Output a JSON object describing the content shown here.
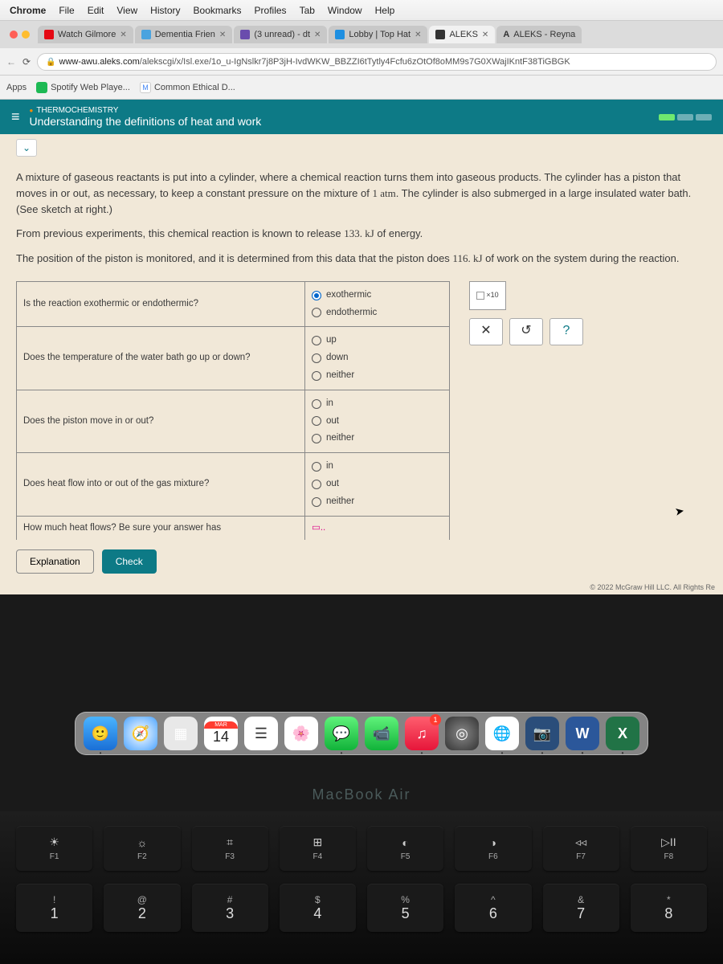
{
  "macMenu": {
    "app": "Chrome",
    "items": [
      "File",
      "Edit",
      "View",
      "History",
      "Bookmarks",
      "Profiles",
      "Tab",
      "Window",
      "Help"
    ]
  },
  "tabs": [
    {
      "label": "Watch Gilmore",
      "favi": "#e50914"
    },
    {
      "label": "Dementia Frien",
      "favi": "#4aa3df"
    },
    {
      "label": "(3 unread) - dt",
      "favi": "#6a4cad"
    },
    {
      "label": "Lobby | Top Hat",
      "favi": "#1e8fe1"
    },
    {
      "label": "ALEKS",
      "favi": "#333",
      "active": true
    },
    {
      "label": "ALEKS - Reyna",
      "favi": "#333"
    }
  ],
  "url": {
    "host": "www-awu.aleks.com",
    "path": "/alekscgi/x/Isl.exe/1o_u-IgNslkr7j8P3jH-IvdWKW_BBZZI6tTytly4Fcfu6zOtOf8oMM9s7G0XWajIKntF38TiGBGK"
  },
  "apps": {
    "label": "Apps",
    "items": [
      {
        "name": "Spotify Web Playe...",
        "color": "#1db954"
      },
      {
        "name": "Common Ethical D...",
        "color": "#4285f4",
        "letter": "M"
      }
    ]
  },
  "header": {
    "category": "THERMOCHEMISTRY",
    "title": "Understanding the definitions of heat and work"
  },
  "passage": {
    "p1a": "A mixture of gaseous reactants is put into a cylinder, where a chemical reaction turns them into gaseous products. The cylinder has a piston that moves in or out, as necessary, to keep a constant pressure on the mixture of ",
    "p1n": "1 atm",
    "p1b": ". The cylinder is also submerged in a large insulated water bath. (See sketch at right.)",
    "p2a": "From previous experiments, this chemical reaction is known to release ",
    "p2n": "133. kJ",
    "p2b": " of energy.",
    "p3a": "The position of the piston is monitored, and it is determined from this data that the piston does ",
    "p3n": "116. kJ",
    "p3b": " of work on the system during the reaction."
  },
  "questions": [
    {
      "q": "Is the reaction exothermic or endothermic?",
      "opts": [
        "exothermic",
        "endothermic"
      ],
      "sel": 0
    },
    {
      "q": "Does the temperature of the water bath go up or down?",
      "opts": [
        "up",
        "down",
        "neither"
      ]
    },
    {
      "q": "Does the piston move in or out?",
      "opts": [
        "in",
        "out",
        "neither"
      ]
    },
    {
      "q": "Does heat flow into or out of the gas mixture?",
      "opts": [
        "in",
        "out",
        "neither"
      ]
    },
    {
      "q": "How much heat flows? Be sure your answer has",
      "opts": []
    }
  ],
  "toolbox": {
    "mult": "×10",
    "clear": "✕",
    "undo": "↺",
    "help": "?"
  },
  "buttons": {
    "explanation": "Explanation",
    "check": "Check"
  },
  "copyright": "© 2022 McGraw Hill LLC. All Rights Re",
  "dock": {
    "calendar": {
      "month": "MAR",
      "day": "14"
    },
    "musicBadge": "1"
  },
  "laptop": "MacBook Air",
  "fkeys": [
    {
      "sym": "☀",
      "lbl": "F1"
    },
    {
      "sym": "☼",
      "lbl": "F2"
    },
    {
      "sym": "⌗",
      "lbl": "F3"
    },
    {
      "sym": "⊞",
      "lbl": "F4"
    },
    {
      "sym": "◐",
      "lbl": "F5"
    },
    {
      "sym": "◑",
      "lbl": "F6"
    },
    {
      "sym": "◃◃",
      "lbl": "F7"
    },
    {
      "sym": "▷II",
      "lbl": "F8"
    }
  ],
  "nkeys": [
    {
      "t": "!",
      "b": "1"
    },
    {
      "t": "@",
      "b": "2"
    },
    {
      "t": "#",
      "b": "3"
    },
    {
      "t": "$",
      "b": "4"
    },
    {
      "t": "%",
      "b": "5"
    },
    {
      "t": "^",
      "b": "6"
    },
    {
      "t": "&",
      "b": "7"
    },
    {
      "t": "*",
      "b": "8"
    }
  ]
}
